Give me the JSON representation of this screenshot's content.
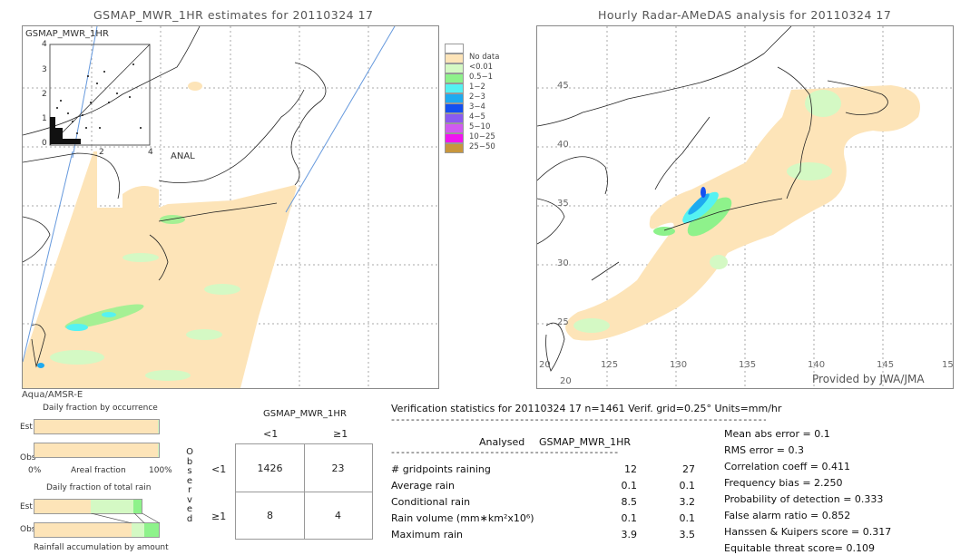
{
  "left_panel": {
    "title": "GSMAP_MWR_1HR estimates for 20110324 17",
    "inset_label": "GSMAP_MWR_1HR",
    "inset_y_ticks": [
      "4",
      "3",
      "2",
      "1",
      "0"
    ],
    "inset_x_ticks": [
      "2",
      "4"
    ],
    "inset_x_label": "ANAL",
    "sensor_label": "Aqua/AMSR-E"
  },
  "right_panel": {
    "title": "Hourly Radar-AMeDAS analysis for 20110324 17",
    "lat_ticks": [
      "45",
      "40",
      "35",
      "30",
      "25",
      "20"
    ],
    "lon_ticks": [
      "125",
      "130",
      "135",
      "140",
      "145",
      "15"
    ],
    "bottom_lat_label": "20",
    "provider_label": "Provided by JWA/JMA"
  },
  "legend": {
    "items": [
      {
        "label": "",
        "color": "#ffffff"
      },
      {
        "label": "No data",
        "color": "#fde4b8"
      },
      {
        "label": "<0.01",
        "color": "#d4f9c4"
      },
      {
        "label": "0.5−1",
        "color": "#8ef28b"
      },
      {
        "label": "1−2",
        "color": "#55f2f2"
      },
      {
        "label": "2−3",
        "color": "#1eaaf0"
      },
      {
        "label": "3−4",
        "color": "#1450f0"
      },
      {
        "label": "4−5",
        "color": "#8a5af0"
      },
      {
        "label": "5−10",
        "color": "#d05af0"
      },
      {
        "label": "10−25",
        "color": "#f014f0"
      },
      {
        "label": "25−50",
        "color": "#c8963c"
      }
    ]
  },
  "fraction_charts": {
    "occurrence_title": "Daily fraction by occurrence",
    "total_rain_title": "Daily fraction of total rain",
    "est_label": "Est",
    "obs_label": "Obs",
    "axis_left": "0%",
    "axis_mid": "Areal fraction",
    "axis_right": "100%",
    "accumulation_label": "Rainfall accumulation by amount",
    "occurrence": {
      "est": [
        {
          "frac": 0.99,
          "color": "#fde4b8"
        },
        {
          "frac": 0.01,
          "color": "#d4f9c4"
        }
      ],
      "obs": [
        {
          "frac": 0.995,
          "color": "#fde4b8"
        },
        {
          "frac": 0.005,
          "color": "#d4f9c4"
        }
      ]
    },
    "total_rain": {
      "est_scale": 0.86,
      "est": [
        {
          "frac": 0.53,
          "color": "#fde4b8"
        },
        {
          "frac": 0.4,
          "color": "#d4f9c4"
        },
        {
          "frac": 0.07,
          "color": "#8ef28b"
        }
      ],
      "obs": [
        {
          "frac": 0.78,
          "color": "#fde4b8"
        },
        {
          "frac": 0.1,
          "color": "#d4f9c4"
        },
        {
          "frac": 0.12,
          "color": "#8ef28b"
        }
      ]
    }
  },
  "contingency": {
    "title": "GSMAP_MWR_1HR",
    "col_headers": [
      "<1",
      "≥1"
    ],
    "row_headers": [
      "<1",
      "≥1"
    ],
    "side_label": [
      "O",
      "b",
      "s",
      "e",
      "r",
      "v",
      "e",
      "d"
    ],
    "cells": [
      [
        "1426",
        "23"
      ],
      [
        "8",
        "4"
      ]
    ]
  },
  "verification": {
    "header": "Verification statistics for 20110324 17   n=1461   Verif. grid=0.25°   Units=mm/hr",
    "col_analysed": "Analysed",
    "col_model": "GSMAP_MWR_1HR",
    "rows": [
      {
        "label": "# gridpoints raining",
        "analysed": "12",
        "model": "27"
      },
      {
        "label": "Average rain",
        "analysed": "0.1",
        "model": "0.1"
      },
      {
        "label": "Conditional rain",
        "analysed": "8.5",
        "model": "3.2"
      },
      {
        "label": "Rain volume (mm∗km²x10⁶)",
        "analysed": "0.1",
        "model": "0.1"
      },
      {
        "label": "Maximum rain",
        "analysed": "3.9",
        "model": "3.5"
      }
    ],
    "scores": [
      "Mean abs error = 0.1",
      "RMS error = 0.3",
      "Correlation coeff = 0.411",
      "Frequency bias = 2.250",
      "Probability of detection = 0.333",
      "False alarm ratio = 0.852",
      "Hanssen & Kuipers score = 0.317",
      "Equitable threat score= 0.109"
    ]
  }
}
